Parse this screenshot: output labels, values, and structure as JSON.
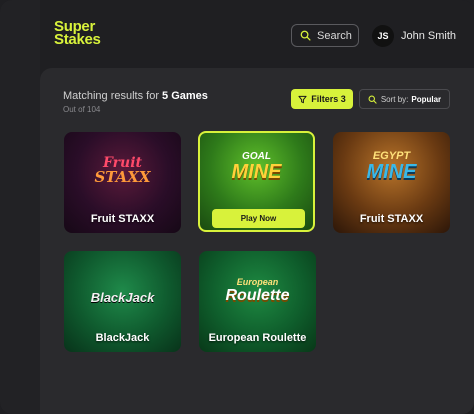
{
  "brand": {
    "line1": "Super",
    "line2": "Stakes",
    "accent": "#d8f23b"
  },
  "header": {
    "search_label": "Search",
    "user_initials": "JS",
    "user_name": "John Smith"
  },
  "results": {
    "prefix": "Matching results for ",
    "count_label": "5 Games",
    "out_of": "Out of 104"
  },
  "toolbar": {
    "filters_label": "Filters 3",
    "sort_prefix": "Sort by:",
    "sort_value": "Popular"
  },
  "games": [
    {
      "title": "Fruit STAXX",
      "art_top": "Fruit",
      "art_bottom": "STAXX"
    },
    {
      "title": "Goal Mine",
      "art_top": "GOAL",
      "art_bottom": "MINE",
      "cta": "Play Now"
    },
    {
      "title": "Fruit STAXX",
      "art_top": "EGYPT",
      "art_bottom": "MINE"
    },
    {
      "title": "BlackJack",
      "art_top": "BlackJack"
    },
    {
      "title": "European Roulette",
      "art_top": "European",
      "art_bottom": "Roulette"
    }
  ]
}
